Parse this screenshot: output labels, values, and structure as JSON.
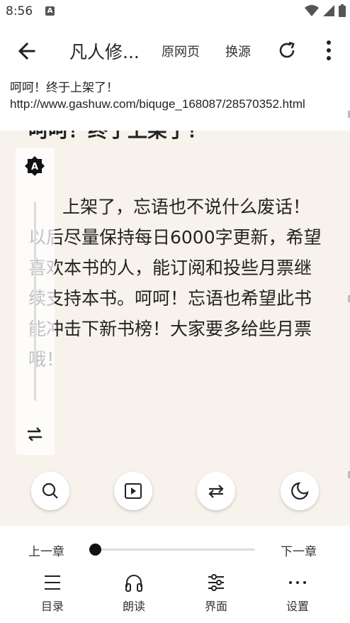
{
  "status_bar": {
    "time": "8:56",
    "notification_icon": "A"
  },
  "toolbar": {
    "book_title": "凡人修...",
    "original_page_label": "原网页",
    "change_source_label": "换源"
  },
  "chapter": {
    "title": "呵呵！终于上架了！",
    "url": "http://www.gashuw.com/biquge_168087/28570352.html",
    "partial_heading": "呵呵！终于上架了！"
  },
  "content": {
    "paragraph": "上架了，忘语也不说什么废话！以后尽量保持每日6000字更新，希望喜欢本书的人，能订阅和投些月票继续支持本书。呵呵！忘语也希望此书能冲击下新书榜！大家要多给些月票哦！"
  },
  "brightness": {
    "auto_label": "A",
    "level": 0
  },
  "quick_actions": [
    {
      "icon": "search-icon"
    },
    {
      "icon": "play-icon"
    },
    {
      "icon": "repeat-icon"
    },
    {
      "icon": "moon-icon"
    }
  ],
  "chapter_nav": {
    "prev_label": "上一章",
    "next_label": "下一章",
    "progress": 0
  },
  "bottom_nav": [
    {
      "label": "目录",
      "icon": "menu-icon"
    },
    {
      "label": "朗读",
      "icon": "headphones-icon"
    },
    {
      "label": "界面",
      "icon": "sliders-icon"
    },
    {
      "label": "设置",
      "icon": "more-horiz-icon"
    }
  ],
  "colors": {
    "reader_background": "#f7f3ec",
    "accent": "#111111"
  }
}
